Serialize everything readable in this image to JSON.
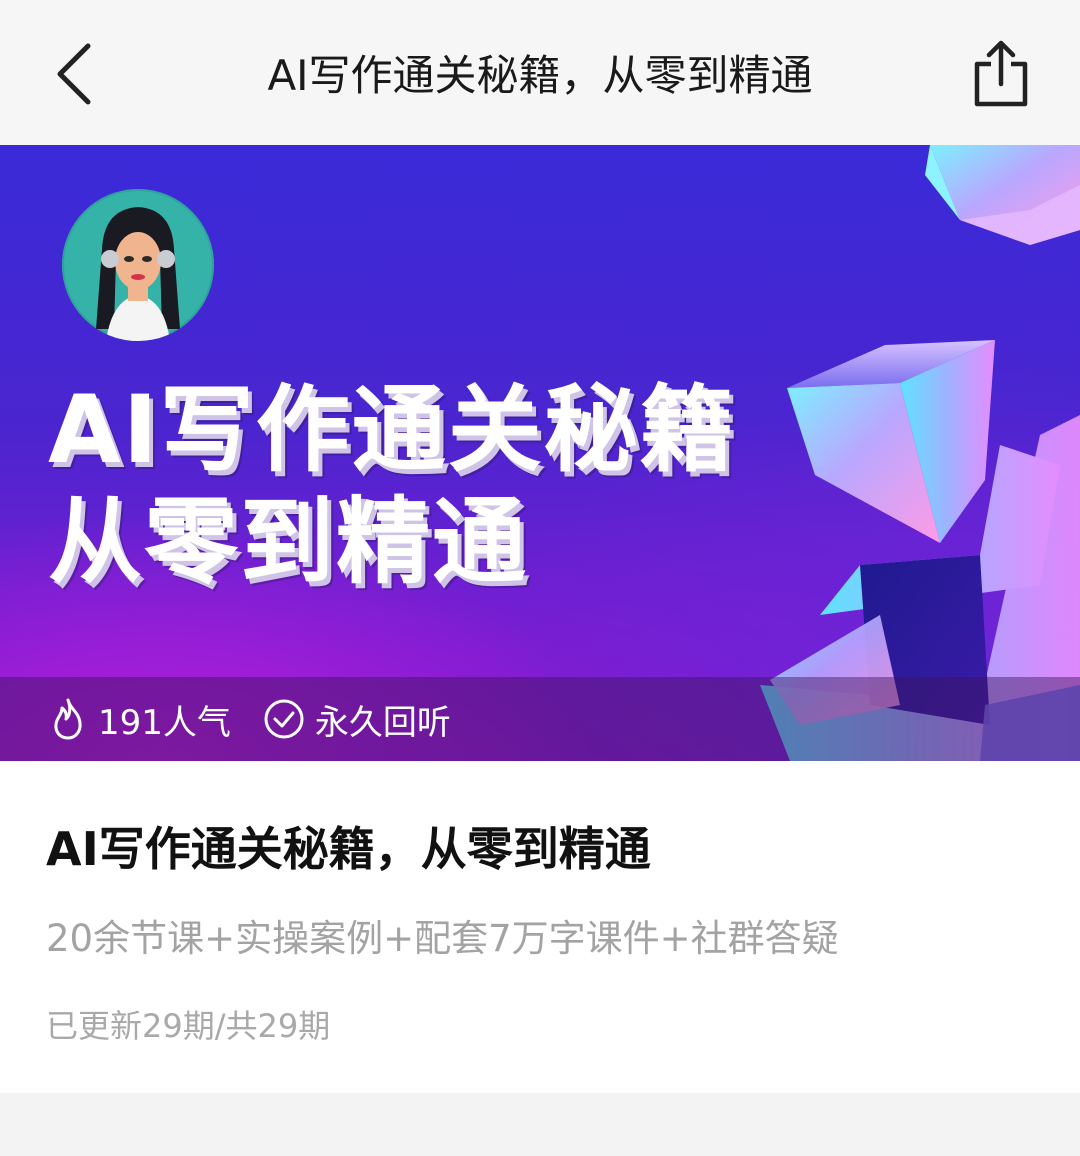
{
  "navbar": {
    "title": "AI写作通关秘籍，从零到精通",
    "back_icon": "chevron-left-icon",
    "share_icon": "share-icon"
  },
  "banner": {
    "title_line1": "AI写作通关秘籍",
    "title_line2": "从零到精通",
    "stats": {
      "popularity": "191人气",
      "popularity_icon": "flame-icon",
      "replay": "永久回听",
      "replay_icon": "check-circle-icon"
    }
  },
  "course": {
    "title": "AI写作通关秘籍，从零到精通",
    "description": "20余节课+实操案例+配套7万字课件+社群答疑",
    "update_status": "已更新29期/共29期"
  },
  "colors": {
    "banner_start": "#3a2ad8",
    "banner_end": "#8a1bd0",
    "title_text": "#111111",
    "muted_text": "#a3a3a3"
  }
}
